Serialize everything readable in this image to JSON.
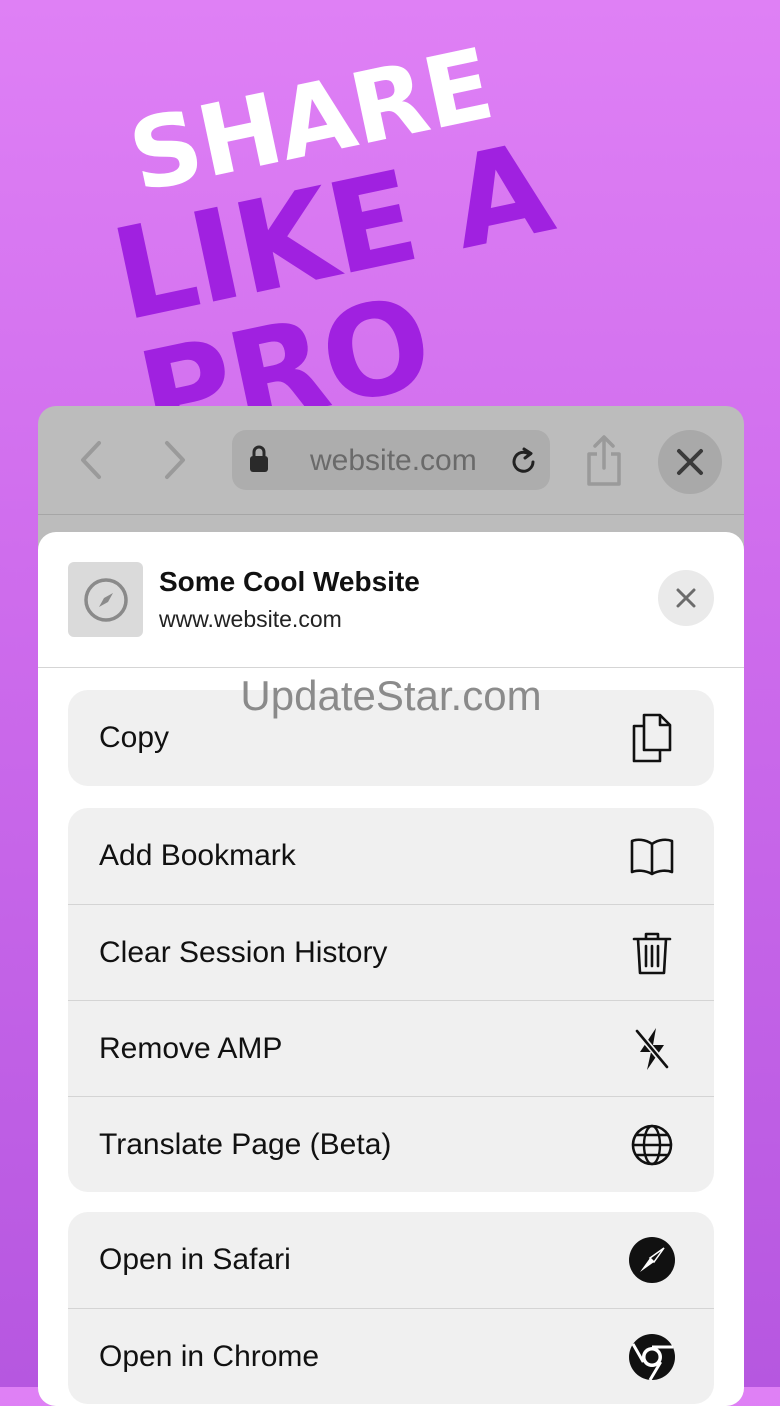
{
  "headline": {
    "line1": "SHARE",
    "line2": "LIKE A PRO"
  },
  "browser": {
    "url": "website.com",
    "icons": [
      "chevron-left-icon",
      "chevron-right-icon",
      "lock-icon",
      "reload-icon",
      "share-icon",
      "close-icon"
    ]
  },
  "sheet": {
    "title": "Some Cool Website",
    "url": "www.website.com",
    "thumb_icon": "compass-icon",
    "close_icon": "close-icon"
  },
  "watermark": "UpdateStar.com",
  "groups": [
    {
      "items": [
        {
          "label": "Copy",
          "icon": "copy-icon"
        }
      ]
    },
    {
      "items": [
        {
          "label": "Add Bookmark",
          "icon": "book-icon"
        },
        {
          "label": "Clear Session History",
          "icon": "trash-icon"
        },
        {
          "label": "Remove AMP",
          "icon": "bolt-slash-icon"
        },
        {
          "label": "Translate Page (Beta)",
          "icon": "globe-icon"
        }
      ]
    },
    {
      "items": [
        {
          "label": "Open in Safari",
          "icon": "safari-icon"
        },
        {
          "label": "Open in Chrome",
          "icon": "chrome-icon"
        }
      ]
    }
  ]
}
